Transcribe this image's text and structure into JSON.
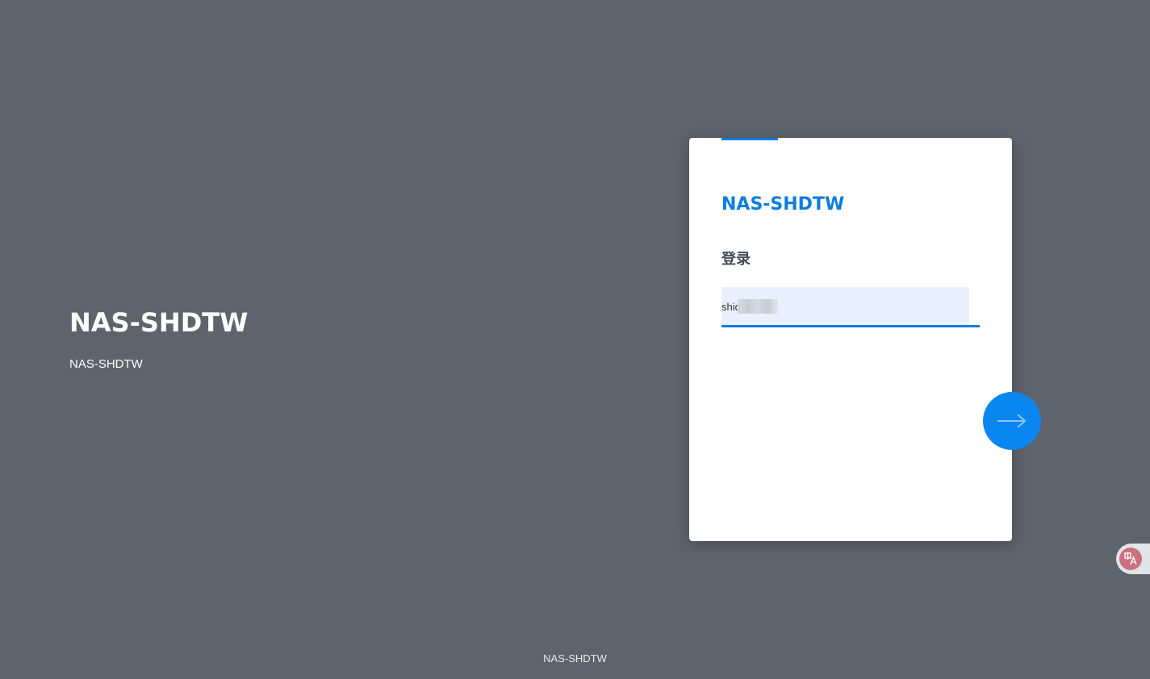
{
  "branding": {
    "title": "NAS-SHDTW",
    "subtitle": "NAS-SHDTW"
  },
  "login_card": {
    "title": "NAS-SHDTW",
    "heading": "登录",
    "username_value": "shiq"
  },
  "next_button": {
    "icon": "arrow-right-icon"
  },
  "footer": {
    "text": "NAS-SHDTW"
  },
  "translate_widget": {
    "icon": "translate-icon"
  },
  "colors": {
    "background": "#5f636b",
    "accent": "#0a7de0",
    "button": "#0a86f0",
    "input_fill": "#e8f0fe"
  }
}
